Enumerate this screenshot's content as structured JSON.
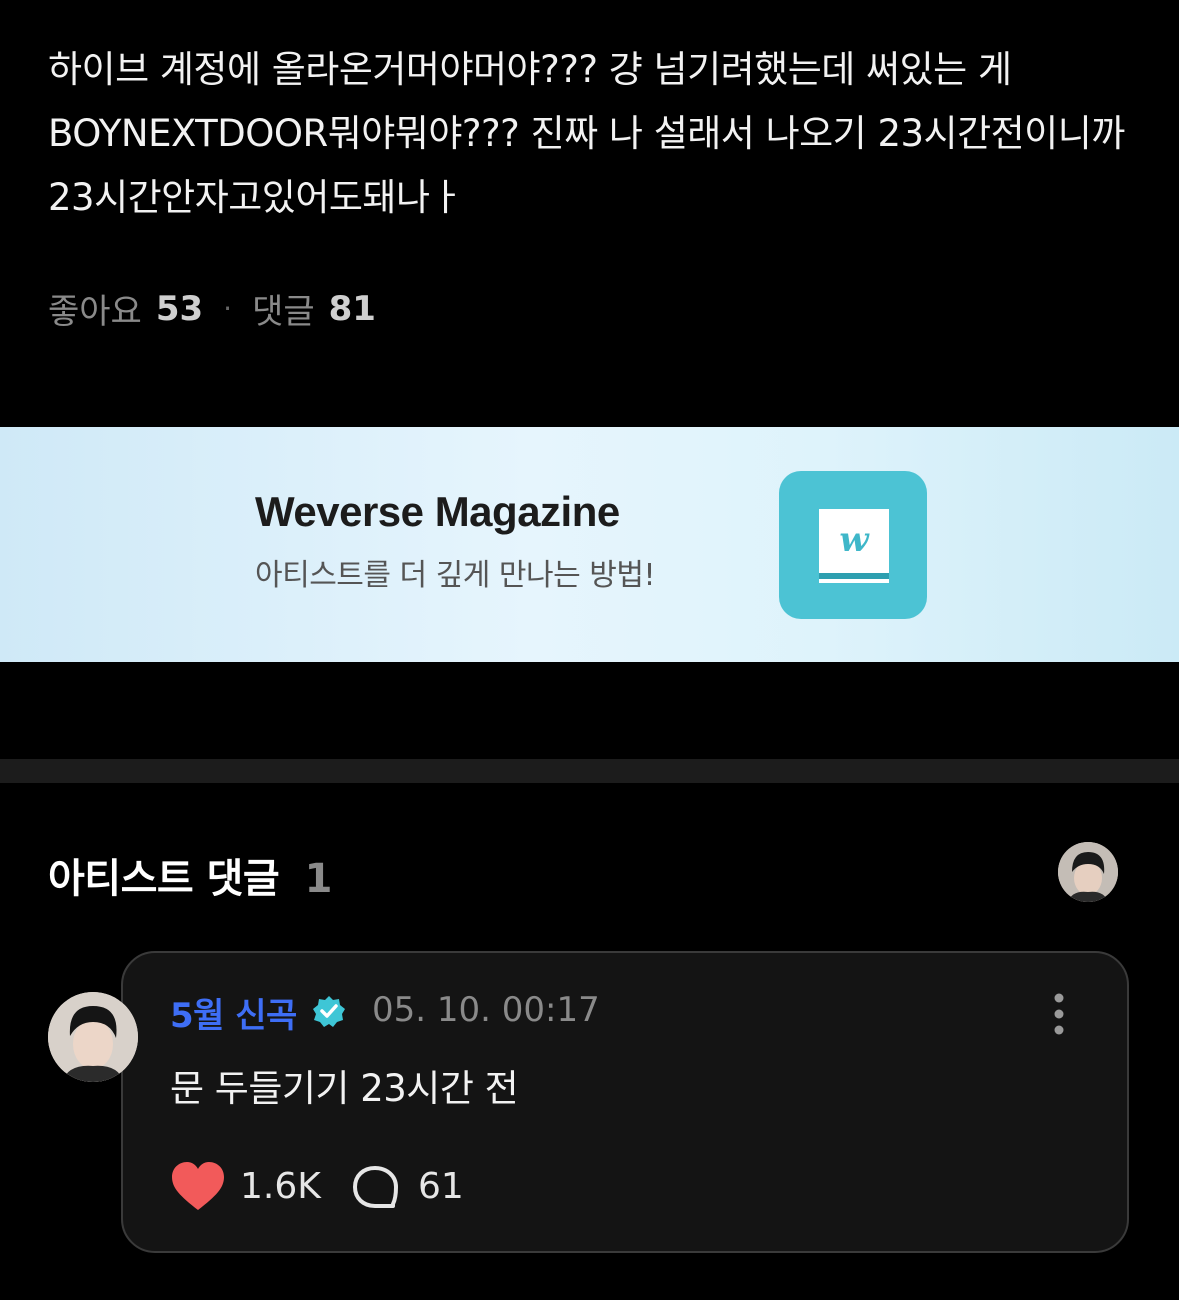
{
  "post": {
    "body": "하이브 계정에 올라온거머야머야??? 걍 넘기려했는데 써있는 게 BOYNEXTDOOR뭐야뭐야??? 진짜 나 설래서 나오기 23시간전이니까 23시간안자고있어도돼나ㅏ",
    "likes_label": "좋아요",
    "likes_count": "53",
    "separator": "·",
    "comments_label": "댓글",
    "comments_count": "81"
  },
  "banner": {
    "title": "Weverse Magazine",
    "subtitle": "아티스트를 더 깊게 만나는 방법!",
    "logo_icon": "weverse-magazine-book-icon",
    "logo_letter": "w",
    "logo_color": "#4cc3d4"
  },
  "artist_comments": {
    "title": "아티스트 댓글",
    "count": "1"
  },
  "comment": {
    "author": "5월 신곡",
    "verified_icon": "verified-badge-icon",
    "timestamp": "05. 10. 00:17",
    "text": "문 두들기기 23시간 전",
    "likes": "1.6K",
    "replies": "61"
  },
  "colors": {
    "background": "#000000",
    "author_blue": "#3e6ef5",
    "heart_red": "#f25a5a",
    "verified_teal": "#3ec6d6"
  }
}
